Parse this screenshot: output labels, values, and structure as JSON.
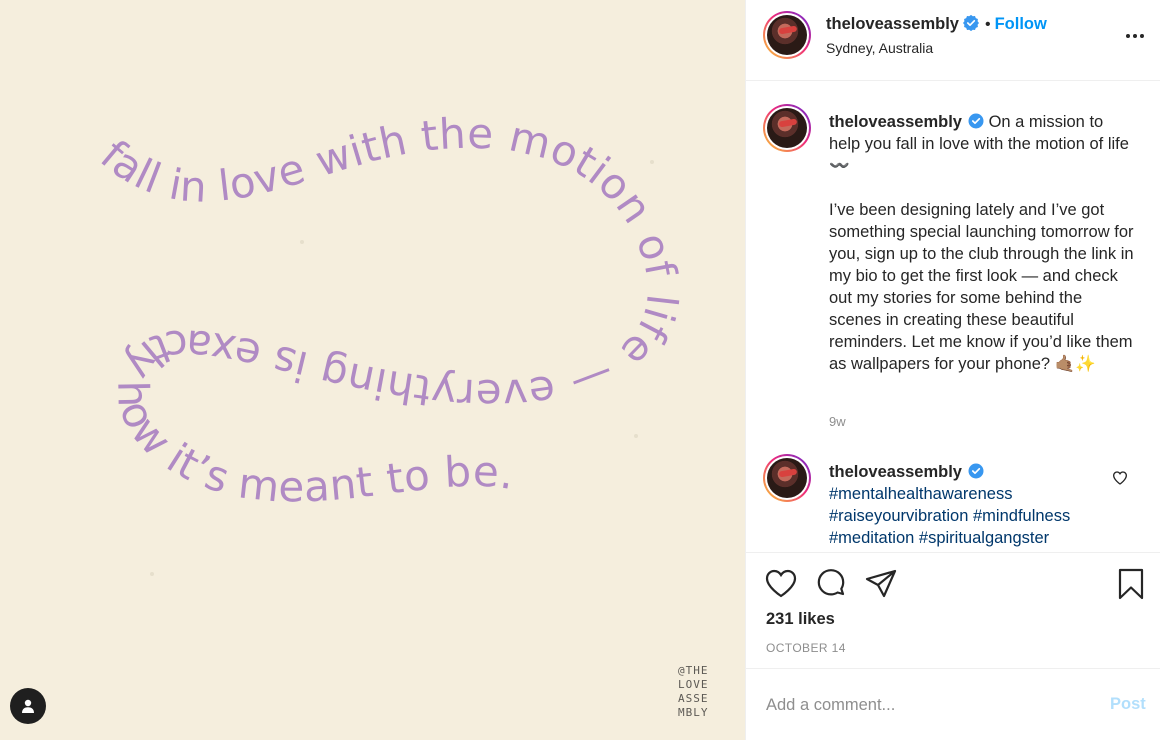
{
  "post": {
    "image_text": {
      "top_arc": "fall in love with the motion of life — everything is exactly how it’s meant to be.",
      "brand_lines": [
        "@THE",
        "LOVE",
        "ASSE",
        "MBLY"
      ]
    }
  },
  "header": {
    "username": "theloveassembly",
    "separator": "•",
    "follow_label": "Follow",
    "location": "Sydney, Australia",
    "more_icon": "ellipsis-icon"
  },
  "caption": {
    "username": "theloveassembly",
    "line1": "On a mission to help you fall in love with the motion of life 〰️",
    "body": "I’ve been designing lately and I’ve got something special launching tomorrow for you, sign up to the club through the link in my bio to get the first look — and check out my stories for some behind the scenes in creating these beautiful reminders. Let me know if you’d like them as wallpapers for your phone? 🤙🏽✨",
    "age": "9w"
  },
  "comment": {
    "username": "theloveassembly",
    "hashtags": [
      "#mentalhealthawareness",
      "#raiseyourvibration",
      "#mindfulness",
      "#meditation",
      "#spiritualgangster"
    ]
  },
  "actions": {
    "likes": "231 likes",
    "date": "OCTOBER 14"
  },
  "add_comment": {
    "placeholder": "Add a comment...",
    "post_label": "Post"
  },
  "colors": {
    "accent": "#0095f6",
    "image_bg": "#f5eedd",
    "image_text": "#b08ac4",
    "hashtag": "#00376b"
  }
}
